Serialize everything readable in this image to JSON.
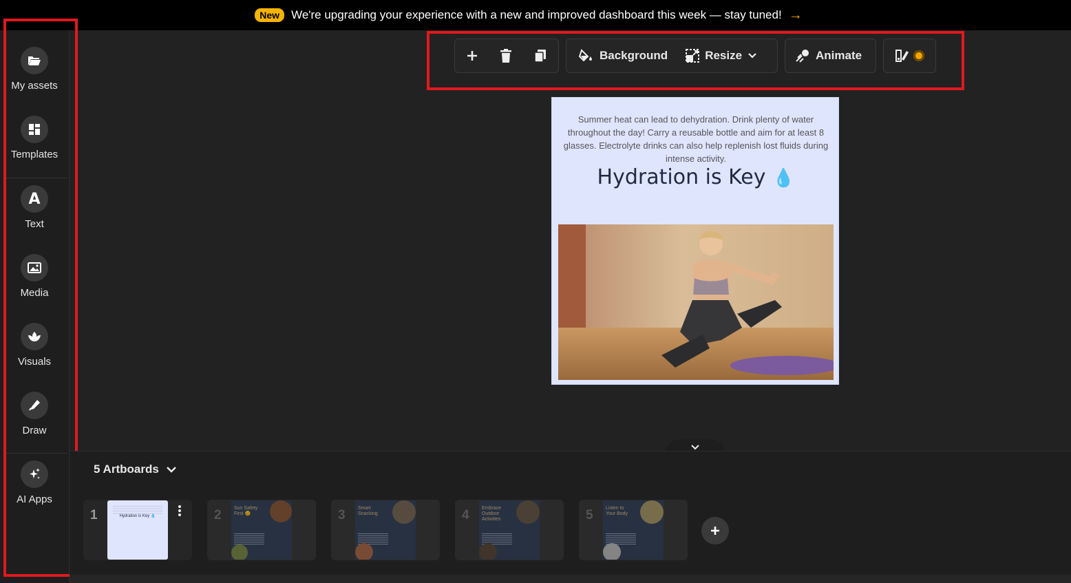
{
  "banner": {
    "badge": "New",
    "text": "We're upgrading your experience with a new and improved dashboard this week — stay tuned!",
    "arrow": "→"
  },
  "sidebar": {
    "items": [
      {
        "label": "My assets",
        "icon": "folder-open-icon"
      },
      {
        "label": "Templates",
        "icon": "templates-grid-icon"
      },
      {
        "label": "Text",
        "icon": "text-a-icon"
      },
      {
        "label": "Media",
        "icon": "image-icon"
      },
      {
        "label": "Visuals",
        "icon": "visuals-icon"
      },
      {
        "label": "Draw",
        "icon": "pen-icon"
      },
      {
        "label": "AI Apps",
        "icon": "sparkles-icon"
      }
    ]
  },
  "toolbar": {
    "background_label": "Background",
    "resize_label": "Resize",
    "animate_label": "Animate"
  },
  "artboard": {
    "body": "Summer heat can lead to dehydration. Drink plenty of water throughout the day! Carry a reusable bottle and aim for at least 8 glasses. Electrolyte drinks can also help replenish lost fluids during intense activity.",
    "title": "Hydration is Key",
    "title_emoji": "💧"
  },
  "bottom_panel": {
    "artboards_label": "5 Artboards",
    "thumbnails": [
      {
        "number": "1",
        "caption": "Hydration is Key 💧"
      },
      {
        "number": "2",
        "caption": "Sun Safety First 🌞"
      },
      {
        "number": "3",
        "caption": "Smart Snacking"
      },
      {
        "number": "4",
        "caption": "Embrace Outdoor Activities"
      },
      {
        "number": "5",
        "caption": "Listen to Your Body"
      }
    ]
  },
  "colors": {
    "accent_red": "#e0191f",
    "badge_yellow": "#f5b400",
    "artboard_bg": "#e0e5fe",
    "thumb_navy": "#26344d"
  }
}
